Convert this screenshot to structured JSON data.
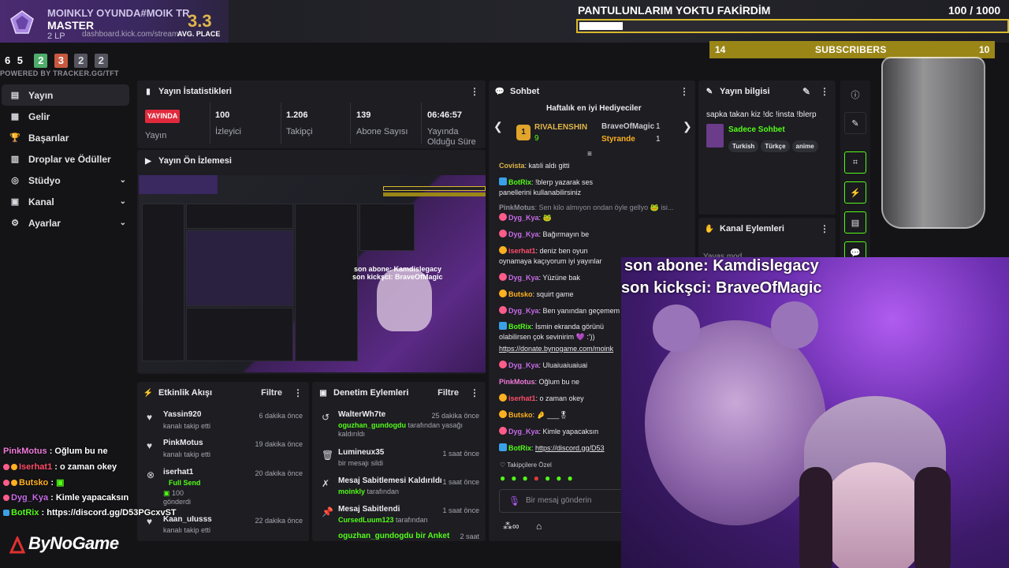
{
  "overlay_rank": {
    "overlay_text": "MOINKLY OYUNDA#MOIK TR",
    "tier": "MASTER",
    "lp": "2 LP",
    "url_fragment": "dashboard.kick.com/stream",
    "avg_value": "3.3",
    "avg_label": "AVG. PLACE",
    "placements": [
      "6",
      "5",
      "2",
      "3",
      "2",
      "2"
    ],
    "placement_colors": [
      "#ffffff",
      "#ffffff",
      "#4fae6a",
      "#c9583e",
      "#6b6b76",
      "#6b6b76"
    ],
    "powered_by": "POWERED BY TRACKER.GG/TFT"
  },
  "goal": {
    "title": "PANTULUNLARIM YOKTU FAKİRDİM",
    "count": "100  / 1000",
    "progress": 0.1
  },
  "subscribers": {
    "left": "14",
    "label": "SUBSCRIBERS",
    "right": "10"
  },
  "sidebar": {
    "items": [
      {
        "label": "Yayın",
        "icon": "stream-icon",
        "active": true
      },
      {
        "label": "Gelir",
        "icon": "revenue-icon"
      },
      {
        "label": "Başarılar",
        "icon": "trophy-icon"
      },
      {
        "label": "Droplar ve Ödüller",
        "icon": "gift-icon"
      },
      {
        "label": "Stüdyo",
        "icon": "studio-icon",
        "chevron": true
      },
      {
        "label": "Kanal",
        "icon": "channel-icon",
        "chevron": true
      },
      {
        "label": "Ayarlar",
        "icon": "gear-icon",
        "chevron": true
      }
    ]
  },
  "stats": {
    "title": "Yayın İstatistikleri",
    "live": "YAYINDA",
    "live_label": "Yayın",
    "items": [
      {
        "value": "100",
        "label": "İzleyici"
      },
      {
        "value": "1.206",
        "label": "Takipçi"
      },
      {
        "value": "139",
        "label": "Abone Sayısı"
      },
      {
        "value": "06:46:57",
        "label": "Yayında Olduğu Süre"
      }
    ]
  },
  "preview": {
    "title": "Yayın Ön İzlemesi",
    "overlay_line1": "son abone: Kamdislegacy",
    "overlay_line2": "son kickşci: BraveOfMagic"
  },
  "activity": {
    "title": "Etkinlik Akışı",
    "filter": "Filtre",
    "items": [
      {
        "name": "Yassin920",
        "sub": "kanalı takip etti",
        "time": "6 dakika önce",
        "icon": "heart-icon"
      },
      {
        "name": "PinkMotus",
        "sub": "kanalı takip etti",
        "time": "19 dakika önce",
        "icon": "heart-icon"
      },
      {
        "name": "iserhat1",
        "sub_green": "Full Send",
        "sub_amount": "100",
        "sub": "gönderdi",
        "time": "20 dakika önce",
        "icon": "kick-gift-icon"
      },
      {
        "name": "Kaan_uIusss",
        "sub": "kanalı takip etti",
        "time": "22 dakika önce",
        "icon": "heart-icon"
      }
    ]
  },
  "moderation": {
    "title": "Denetim Eylemleri",
    "filter": "Filtre",
    "items": [
      {
        "title": "WalterWh7te",
        "user": "oguzhan_gundogdu",
        "sub": "tarafından yasağı",
        "sub2": "kaldırıldı",
        "time": "25 dakika önce",
        "icon": "undo-icon"
      },
      {
        "title": "Lumineux35",
        "sub": "bir mesajı sildi",
        "time": "1 saat önce",
        "icon": "trash-icon"
      },
      {
        "title": "Mesaj Sabitlemesi Kaldırıldı",
        "user": "moinkly",
        "sub": "tarafından",
        "time": "1 saat önce",
        "icon": "unpin-icon"
      },
      {
        "title": "Mesaj Sabitlendi",
        "user": "CursedLuum123",
        "sub": "tarafından",
        "time": "1 saat önce",
        "icon": "pin-icon"
      },
      {
        "title": "oguzhan_gundogdu bir Anket",
        "time": "2 saat",
        "icon": "poll-icon"
      }
    ]
  },
  "chat": {
    "title": "Sohbet",
    "weekly_title": "Haftalık en iyi Hediyeciler",
    "top_gifter": {
      "name": "RIVALENSHIN",
      "amount": "9"
    },
    "gifters": [
      {
        "name": "BraveOfMagic",
        "amount": "1"
      },
      {
        "name": "Styrande",
        "amount": "1"
      }
    ],
    "messages": [
      {
        "user": "Covista",
        "color": "#e0b64a",
        "text": "katıli aldı gitti"
      },
      {
        "user": "BotRix",
        "color": "#53fc18",
        "text": "!blerp yazarak ses panellerini kullanabilirsiniz"
      },
      {
        "user": "PinkMotus",
        "color": "#a4a4ad",
        "text": "Sen kilo almıyon ondan öyle gellyo 🐸 isi..."
      },
      {
        "user": "Dyg_Kya",
        "color": "#c86be8",
        "text": "🐸"
      },
      {
        "user": "Dyg_Kya",
        "color": "#c86be8",
        "text": "Bağırmayın be"
      },
      {
        "user": "iserhat1",
        "color": "#ff4d6a",
        "text": "deniz ben oyun oynamaya kaçıyorum iyi yayınlar"
      },
      {
        "user": "Dyg_Kya",
        "color": "#c86be8",
        "text": "Yüzüne bak"
      },
      {
        "user": "Butsko",
        "color": "#ffb020",
        "text": "squirt game"
      },
      {
        "user": "Dyg_Kya",
        "color": "#c86be8",
        "text": "Ben yanından geçemem"
      },
      {
        "user": "BotRix",
        "color": "#53fc18",
        "text": "İsmin ekranda görünü olabilirsen çok sevinirim 💜 :'))"
      },
      {
        "user": "",
        "color": "#e8e8ec",
        "text": "https://donate.bynogame.com/moink"
      },
      {
        "user": "Dyg_Kya",
        "color": "#c86be8",
        "text": "Uluaiuaiuaiuai"
      },
      {
        "user": "PinkMotus",
        "color": "#f07ad8",
        "text": "Oğlum bu ne"
      },
      {
        "user": "iserhat1",
        "color": "#ff4d6a",
        "text": "o zaman okey"
      },
      {
        "user": "Butsko",
        "color": "#ffb020",
        "text": "🤌 ___🎖"
      },
      {
        "user": "Dyg_Kya",
        "color": "#c86be8",
        "text": "Kimle yapacaksın"
      },
      {
        "user": "BotRix",
        "color": "#53fc18",
        "text": "https://discord.gg/D53"
      }
    ],
    "followers_only": "Takipçilere Özel",
    "placeholder": "Bir mesaj gönderin"
  },
  "info": {
    "title": "Yayın bilgisi",
    "stream_title": "sapka takan kiz !dc !insta !blerp",
    "category": "Sadece Sohbet",
    "tags": [
      "Turkish",
      "Türkçe",
      "anime"
    ]
  },
  "channel_actions": {
    "title": "Kanal Eylemleri",
    "first_item": "Yavaş mod"
  },
  "cam": {
    "line1": "son abone: Kamdislegacy",
    "line2": "son kickşci: BraveOfMagic"
  },
  "overlay_chat": [
    {
      "user": "PinkMotus",
      "color": "#f07ad8",
      "text": ": Oğlum bu ne"
    },
    {
      "user": "Iserhat1",
      "color": "#ff4d6a",
      "text": ": o zaman okey"
    },
    {
      "user": "Butsko",
      "color": "#ffb020",
      "text": ":"
    },
    {
      "user": "Dyg_Kya",
      "color": "#c86be8",
      "text": ": Kimle yapacaksın"
    },
    {
      "user": "BotRix",
      "color": "#53fc18",
      "text": ": https://discord.gg/D53PGcxvST"
    }
  ],
  "brand": "ByNoGame",
  "colors": {
    "kick_green": "#53fc18",
    "live_red": "#e02a3c",
    "goal_gold": "#d9b92c",
    "panel_bg": "#1d1d22"
  }
}
